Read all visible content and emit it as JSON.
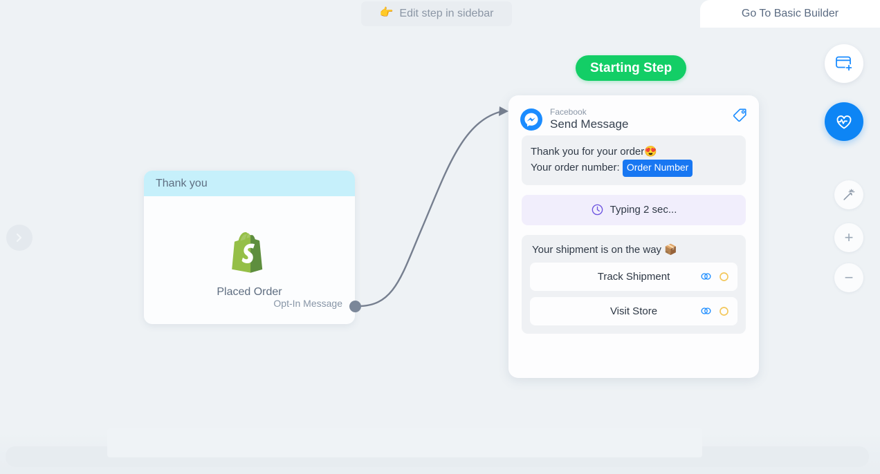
{
  "topbar": {
    "edit_step_label": "Edit step in sidebar",
    "edit_step_icon": "pointing-hand-icon",
    "basic_builder_tab": "Go To Basic Builder"
  },
  "canvas": {
    "collapse_icon": "chevron-right-icon",
    "starting_step_badge": "Starting Step",
    "accent_green": "#13ce66",
    "accent_blue": "#0d85f5",
    "canvas_bg": "#eef2f5"
  },
  "trigger_node": {
    "header_title": "Thank you",
    "header_color": "#c6f0fb",
    "app_icon": "shopify-icon",
    "app_label": "Placed Order",
    "output_label": "Opt-In Message",
    "output_port_icon": "connector-dot-icon"
  },
  "message_card": {
    "channel": "Facebook",
    "title": "Send Message",
    "channel_icon": "facebook-messenger-icon",
    "tag_icon": "tag-icon",
    "blocks": [
      {
        "type": "text",
        "name": "text-block",
        "line1": "Thank you for your order",
        "line1_emoji": "😍",
        "line2_prefix": "Your order number:",
        "variable_chip": "Order Number",
        "chip_color": "#1877f2"
      },
      {
        "type": "typing",
        "name": "typing-delay-block",
        "icon": "clock-icon",
        "label": "Typing 2 sec...",
        "bg": "#f1eefc"
      },
      {
        "type": "card",
        "name": "gallery-card-block",
        "text": "Your shipment is on the way",
        "text_emoji": "📦",
        "buttons": [
          {
            "label": "Track Shipment",
            "link_icon": "link-icon",
            "status_icon": "circle-outline-icon"
          },
          {
            "label": "Visit Store",
            "link_icon": "link-icon",
            "status_icon": "circle-outline-icon"
          }
        ]
      }
    ]
  },
  "toolbar": {
    "items": [
      {
        "name": "add-step-button",
        "icon": "add-card-icon",
        "label": ""
      },
      {
        "name": "flow-health-button",
        "icon": "pulse-heart-icon",
        "label": ""
      },
      {
        "name": "auto-layout-button",
        "icon": "magic-wand-icon",
        "label": ""
      },
      {
        "name": "zoom-in-button",
        "icon": "plus-icon",
        "label": "+"
      },
      {
        "name": "zoom-out-button",
        "icon": "minus-icon",
        "label": "−"
      }
    ]
  }
}
